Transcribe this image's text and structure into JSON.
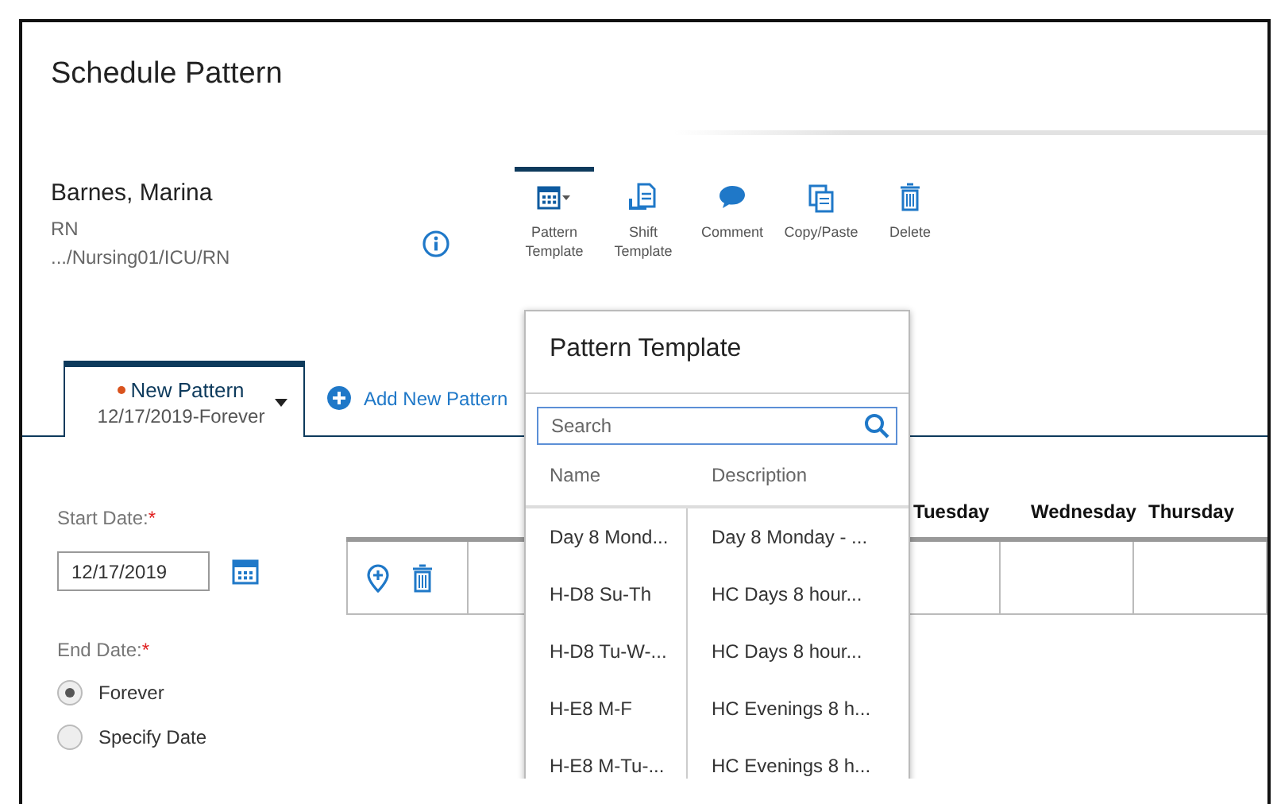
{
  "window": {
    "title": "Schedule Pattern"
  },
  "person": {
    "name": "Barnes, Marina",
    "role": "RN",
    "path": ".../Nursing01/ICU/RN"
  },
  "toolbar": [
    {
      "kind": "pattern",
      "label": "Pattern Template",
      "selected": true
    },
    {
      "kind": "shift",
      "label": "Shift Template",
      "selected": false
    },
    {
      "kind": "comment",
      "label": "Comment",
      "selected": false
    },
    {
      "kind": "copy",
      "label": "Copy/Paste",
      "selected": false
    },
    {
      "kind": "delete",
      "label": "Delete",
      "selected": false
    }
  ],
  "tabs": [
    {
      "title": "New Pattern",
      "dates": "12/17/2019-Forever",
      "selected": true,
      "unsaved": true
    }
  ],
  "add_tab": "Add New Pattern",
  "form": {
    "start_label": "Start Date:",
    "start_required": "*",
    "start_value": "12/17/2019",
    "end_label": "End Date:",
    "end_required": "*",
    "options": [
      {
        "label": "Forever",
        "selected": true
      },
      {
        "label": "Specify Date",
        "selected": false
      }
    ]
  },
  "grid": {
    "columns": [
      "Tuesday",
      "Wednesday",
      "Thursday"
    ]
  },
  "popup": {
    "title": "Pattern Template",
    "search_placeholder": "Search",
    "columns": [
      "Name",
      "Description"
    ],
    "rows": [
      [
        "Day 8 Mond...",
        "Day 8 Monday - ..."
      ],
      [
        "H-D8 Su-Th",
        "HC Days 8 hour..."
      ],
      [
        "H-D8 Tu-W-...",
        "HC Days 8 hour..."
      ],
      [
        "H-E8 M-F",
        "HC Evenings 8 h..."
      ],
      [
        "H-E8 M-Tu-...",
        "HC Evenings 8 h..."
      ]
    ]
  }
}
